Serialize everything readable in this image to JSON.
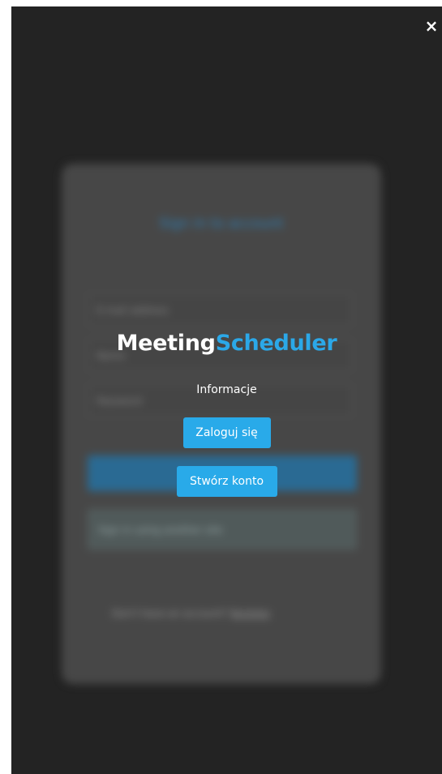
{
  "background_form": {
    "title": "Sign in to account",
    "email_placeholder": "E-mail address",
    "name_placeholder": "Name",
    "password_placeholder": "Password",
    "alt_login_label": "Sign in using another site",
    "footer_text": "Don't have an account?",
    "footer_link": "Register"
  },
  "menu": {
    "logo_part1": "Meeting",
    "logo_part2": "Scheduler",
    "info_link": "Informacje",
    "login_button": "Zaloguj się",
    "register_button": "Stwórz konto",
    "close_icon": "×"
  },
  "colors": {
    "overlay_background": "#232323",
    "accent_blue": "#29aae9",
    "logo_white": "#ffffff"
  }
}
